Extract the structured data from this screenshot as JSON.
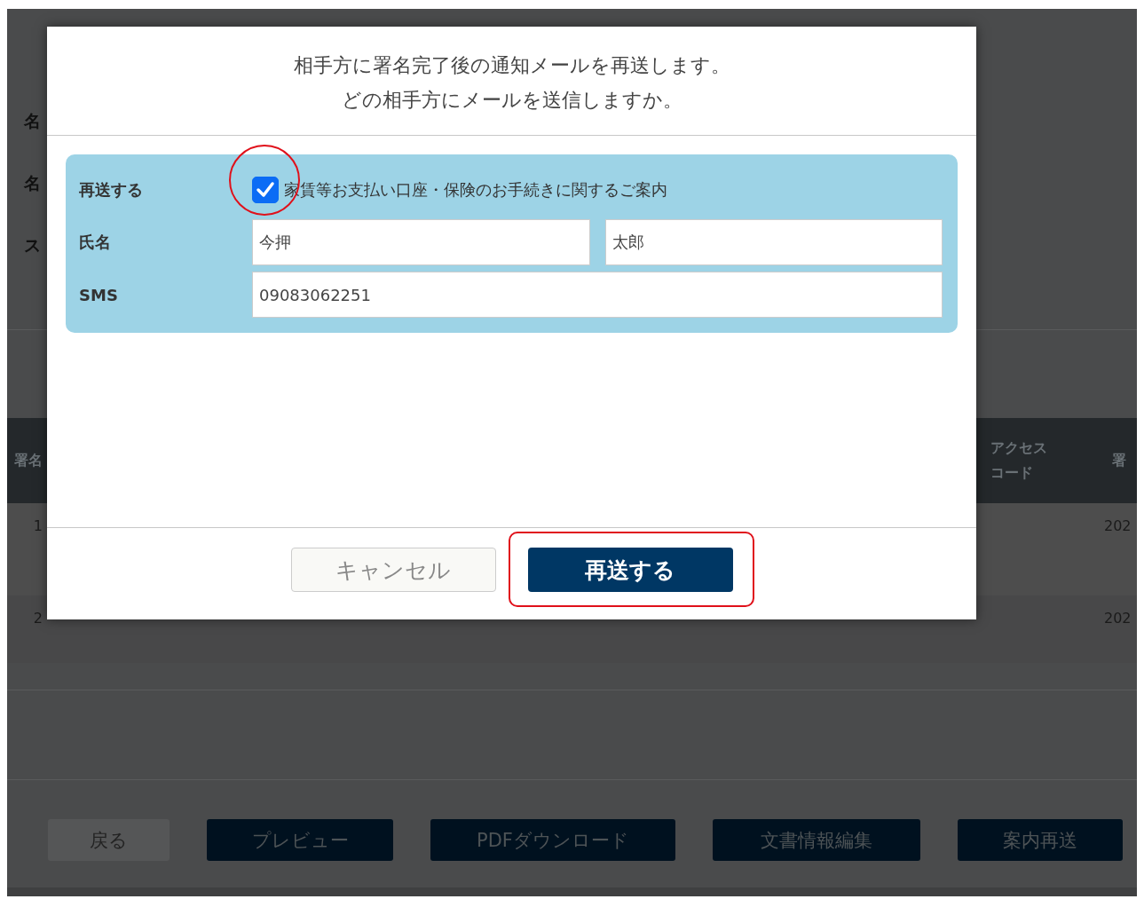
{
  "background": {
    "field_labels": [
      "名",
      "名",
      "ス"
    ],
    "table": {
      "columns": [
        "署名",
        "アクセスコード",
        "署"
      ],
      "rows": [
        {
          "number": "1",
          "date": "202"
        },
        {
          "number": "2",
          "date": "202"
        }
      ]
    },
    "buttons": [
      {
        "label": "戻る",
        "kind": "secondary"
      },
      {
        "label": "プレビュー",
        "kind": "primary"
      },
      {
        "label": "PDFダウンロード",
        "kind": "primary"
      },
      {
        "label": "文書情報編集",
        "kind": "primary"
      },
      {
        "label": "案内再送",
        "kind": "primary"
      }
    ]
  },
  "dialog": {
    "message": [
      "相手方に署名完了後の通知メールを再送します。",
      "どの相手方にメールを送信しますか。"
    ],
    "recipient": {
      "resend_label": "再送する",
      "checked": true,
      "document": "家賃等お支払い口座・保険のお手続きに関するご案内",
      "name_label": "氏名",
      "last_name": "今押",
      "first_name": "太郎",
      "sms_label": "SMS",
      "sms": "09083062251"
    },
    "buttons": [
      {
        "label": "キャンセル",
        "kind": "secondary"
      },
      {
        "label": "再送する",
        "kind": "primary",
        "highlighted": true
      }
    ]
  }
}
